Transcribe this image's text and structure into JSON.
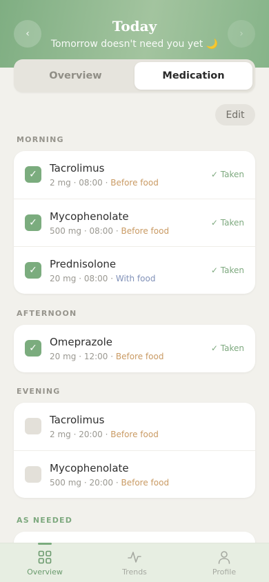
{
  "header": {
    "title": "Today",
    "subtitle": "Tomorrow doesn't need you yet 🌙",
    "prev_icon": "‹",
    "next_icon": "›"
  },
  "tabs": [
    {
      "label": "Overview",
      "active": false
    },
    {
      "label": "Medication",
      "active": true
    }
  ],
  "edit_label": "Edit",
  "sections": {
    "morning": "MORNING",
    "afternoon": "AFTERNOON",
    "evening": "EVENING",
    "as_needed": "AS NEEDED"
  },
  "meds": {
    "morning": [
      {
        "name": "Tacrolimus",
        "meta": "2 mg · 08:00 · ",
        "food": "Before food",
        "status": "✓ Taken",
        "checked": true
      },
      {
        "name": "Mycophenolate",
        "meta": "500 mg · 08:00 · ",
        "food": "Before food",
        "status": "✓ Taken",
        "checked": true
      },
      {
        "name": "Prednisolone",
        "meta": "20 mg · 08:00 · ",
        "food": "With food",
        "status": "✓ Taken",
        "checked": true
      }
    ],
    "afternoon": [
      {
        "name": "Omeprazole",
        "meta": "20 mg · 12:00 · ",
        "food": "Before food",
        "status": "✓ Taken",
        "checked": true
      }
    ],
    "evening": [
      {
        "name": "Tacrolimus",
        "meta": "2 mg · 20:00 · ",
        "food": "Before food",
        "status": "",
        "checked": false
      },
      {
        "name": "Mycophenolate",
        "meta": "500 mg · 20:00 · ",
        "food": "Before food",
        "status": "",
        "checked": false
      }
    ]
  },
  "check_glyph": "✓",
  "bottom_nav": [
    {
      "label": "Overview",
      "icon": "grid-icon",
      "active": true
    },
    {
      "label": "Trends",
      "icon": "pulse-icon",
      "active": false
    },
    {
      "label": "Profile",
      "icon": "person-icon",
      "active": false
    }
  ],
  "colors": {
    "accent": "#7bac7e",
    "before_food": "#c99a63",
    "with_food": "#8191b8",
    "background": "#f2f1ec"
  }
}
